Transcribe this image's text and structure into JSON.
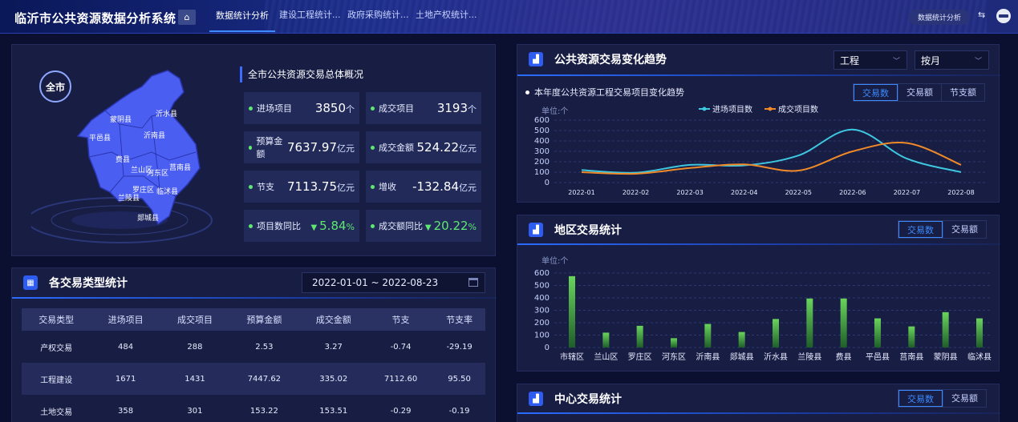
{
  "header": {
    "title": "临沂市公共资源数据分析系统",
    "tabs": [
      {
        "label": "数据统计分析",
        "active": true
      },
      {
        "label": "建设工程统计..."
      },
      {
        "label": "政府采购统计..."
      },
      {
        "label": "土地产权统计..."
      }
    ],
    "right_button": "数据统计分析",
    "home_icon": "home-icon",
    "switch_icon": "swap-icon",
    "avatar_icon": "user-avatar-icon"
  },
  "overview": {
    "badge": "全市",
    "heading": "全市公共资源交易总体概况",
    "map_regions": [
      "蒙阴县",
      "沂水县",
      "平邑县",
      "沂南县",
      "费县",
      "兰山区",
      "河东区",
      "莒南县",
      "罗庄区",
      "临沭县",
      "兰陵县",
      "郯城县"
    ],
    "cells": [
      {
        "label": "进场项目",
        "value": "3850",
        "unit": "个"
      },
      {
        "label": "成交项目",
        "value": "3193",
        "unit": "个"
      },
      {
        "label": "预算金额",
        "value": "7637.97",
        "unit": "亿元"
      },
      {
        "label": "成交金额",
        "value": "524.22",
        "unit": "亿元"
      },
      {
        "label": "节支",
        "value": "7113.75",
        "unit": "亿元"
      },
      {
        "label": "增收",
        "value": "-132.84",
        "unit": "亿元"
      },
      {
        "label": "项目数同比",
        "value": "5.84",
        "unit": "%",
        "trend": "down"
      },
      {
        "label": "成交额同比",
        "value": "20.22",
        "unit": "%",
        "trend": "down"
      }
    ]
  },
  "type_stats": {
    "title": "各交易类型统计",
    "date_range": "2022-01-01 ~ 2022-08-23",
    "columns": [
      "交易类型",
      "进场项目",
      "成交项目",
      "预算金额",
      "成交金额",
      "节支",
      "节支率"
    ],
    "rows": [
      [
        "产权交易",
        "484",
        "288",
        "2.53",
        "3.27",
        "-0.74",
        "-29.19"
      ],
      [
        "工程建设",
        "1671",
        "1431",
        "7447.62",
        "335.02",
        "7112.60",
        "95.50"
      ],
      [
        "土地交易",
        "358",
        "301",
        "153.22",
        "153.51",
        "-0.29",
        "-0.19"
      ]
    ]
  },
  "trend": {
    "title": "公共资源交易变化趋势",
    "select_type": "工程",
    "select_period": "按月",
    "subtitle": "本年度公共资源工程交易项目变化趋势",
    "tabs": [
      "交易数",
      "交易额",
      "节支额"
    ],
    "active_tab": "交易数"
  },
  "region": {
    "title": "地区交易统计",
    "tabs": [
      "交易数",
      "交易额"
    ],
    "active_tab": "交易数"
  },
  "center": {
    "title": "中心交易统计",
    "tabs": [
      "交易数",
      "交易额"
    ],
    "active_tab": "交易数"
  },
  "colors": {
    "accent": "#3d8bff",
    "line_in": "#3ec8e0",
    "line_deal": "#f08a28",
    "bar": "#4fbf4a",
    "green": "#5ee870"
  },
  "chart_data": [
    {
      "type": "line",
      "x": [
        "2022-01",
        "2022-02",
        "2022-03",
        "2022-04",
        "2022-05",
        "2022-06",
        "2022-07",
        "2022-08"
      ],
      "series": [
        {
          "name": "进场项目数",
          "values": [
            120,
            95,
            170,
            165,
            260,
            510,
            230,
            100
          ]
        },
        {
          "name": "成交项目数",
          "values": [
            100,
            85,
            140,
            175,
            115,
            300,
            380,
            170
          ]
        }
      ],
      "ylabel": "单位:个",
      "ylim": [
        0,
        600
      ],
      "yticks": [
        0,
        100,
        200,
        300,
        400,
        500,
        600
      ],
      "legend": "top-center",
      "grid": true
    },
    {
      "type": "bar",
      "categories": [
        "市辖区",
        "兰山区",
        "罗庄区",
        "河东区",
        "沂南县",
        "郯城县",
        "沂水县",
        "兰陵县",
        "费县",
        "平邑县",
        "莒南县",
        "蒙阴县",
        "临沭县"
      ],
      "values": [
        575,
        120,
        175,
        75,
        190,
        125,
        230,
        395,
        395,
        235,
        170,
        285,
        235
      ],
      "ylabel": "单位:个",
      "ylim": [
        0,
        600
      ],
      "yticks": [
        0,
        100,
        200,
        300,
        400,
        500,
        600
      ],
      "grid": true
    }
  ]
}
